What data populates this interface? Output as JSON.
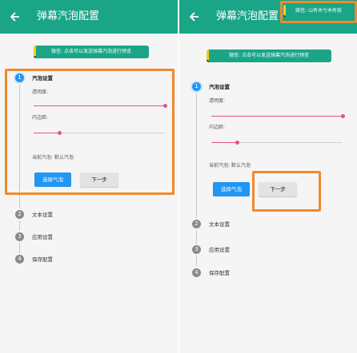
{
  "colors": {
    "appbar": "#1aa587",
    "primary_button": "#2196f3",
    "active_step": "#2196f3",
    "inactive_step": "#8a8a8a",
    "slider": "#e8508a",
    "highlight": "#f08a2e"
  },
  "icons": {
    "back": "back-arrow-icon"
  },
  "appbar": {
    "title": "弹幕汽泡配置"
  },
  "tip_text": "微信: 点击可以发送弹幕汽泡进行预览",
  "toast_text": "微信: 山有木兮木有枝",
  "steps": [
    {
      "number": "1",
      "title": "汽泡设置"
    },
    {
      "number": "2",
      "title": "文本设置"
    },
    {
      "number": "3",
      "title": "应用设置"
    },
    {
      "number": "4",
      "title": "保存配置"
    }
  ],
  "settings": {
    "opacity_label": "透明度:",
    "opacity_value": 1.0,
    "padding_label": "内边距:",
    "padding_value": 0.2,
    "current_bubble": "当前汽泡: 默认汽泡"
  },
  "buttons": {
    "select_bubble": "选择气泡",
    "next": "下一步"
  }
}
